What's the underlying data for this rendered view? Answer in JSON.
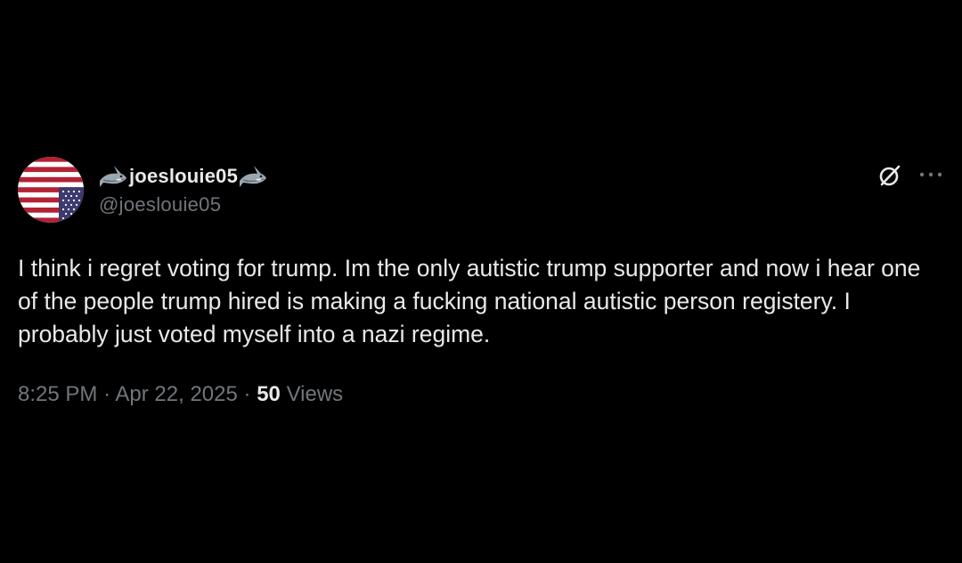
{
  "tweet": {
    "display_name": "joeslouie05",
    "handle": "@joeslouie05",
    "name_emoji": "shark-icon",
    "avatar": "us-flag-upside-down",
    "text": "I think i regret voting for trump. Im the only autistic trump supporter and now i hear one of the people trump hired is making a fucking national autistic person registery. I probably just voted myself into a nazi regime.",
    "time": "8:25 PM",
    "separator": "·",
    "date": "Apr 22, 2025",
    "views_count": "50",
    "views_label": "Views"
  },
  "colors": {
    "background": "#000000",
    "primary_text": "#e7e9ea",
    "secondary_text": "#71767b"
  }
}
